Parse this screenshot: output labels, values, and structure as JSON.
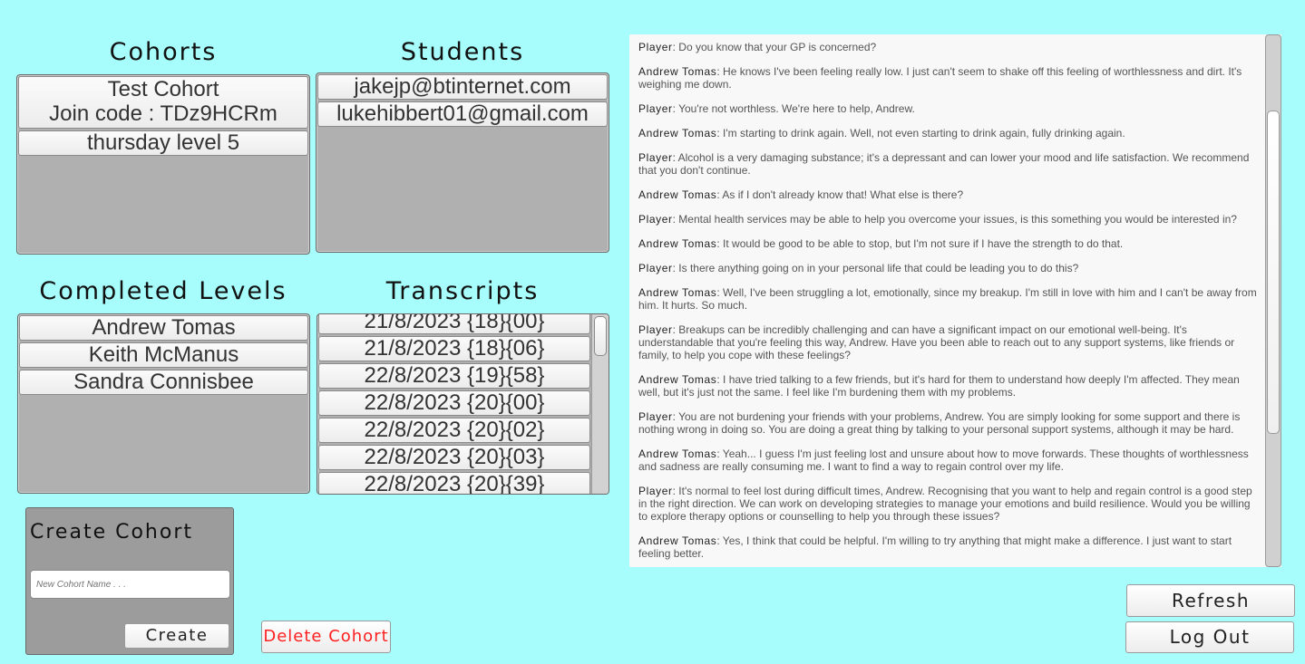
{
  "cohorts": {
    "heading": "Cohorts",
    "items": [
      {
        "line1": "Test Cohort",
        "line2": "Join code : TDz9HCRm"
      },
      {
        "line1": "thursday level 5"
      }
    ]
  },
  "students": {
    "heading": "Students",
    "items": [
      "jakejp@btinternet.com",
      "lukehibbert01@gmail.com"
    ]
  },
  "completed_levels": {
    "heading": "Completed Levels",
    "items": [
      "Andrew Tomas",
      "Keith McManus",
      "Sandra Connisbee"
    ]
  },
  "transcripts": {
    "heading": "Transcripts",
    "items": [
      "21/8/2023 {18}{00}",
      "21/8/2023 {18}{06}",
      "22/8/2023 {19}{58}",
      "22/8/2023 {20}{00}",
      "22/8/2023 {20}{02}",
      "22/8/2023 {20}{03}",
      "22/8/2023 {20}{39}"
    ]
  },
  "create_cohort": {
    "heading": "Create Cohort",
    "placeholder": "New Cohort Name . . .",
    "value": "",
    "create_label": "Create"
  },
  "delete_cohort_label": "Delete Cohort",
  "refresh_label": "Refresh",
  "logout_label": "Log Out",
  "colors": {
    "background": "#a6fdfb",
    "delete_text": "#ff2020"
  },
  "conversation": [
    {
      "speaker": "Player",
      "text": ": Do you know that your GP is concerned?"
    },
    {
      "speaker": "Andrew Tomas",
      "text": ": He knows I've been feeling really low. I just can't seem to shake off this feeling of worthlessness and dirt. It's weighing me down."
    },
    {
      "speaker": "Player",
      "text": ": You're not worthless. We're here to help, Andrew."
    },
    {
      "speaker": "Andrew Tomas",
      "text": ": I'm starting to drink again. Well, not even starting to drink again, fully drinking again."
    },
    {
      "speaker": "Player",
      "text": ": Alcohol is a very damaging substance; it's a depressant and can lower your mood and life satisfaction. We recommend that you don't continue."
    },
    {
      "speaker": "Andrew Tomas",
      "text": ": As if I don't already know that! What else is there?"
    },
    {
      "speaker": "Player",
      "text": ": Mental health services may be able to help you overcome your issues, is this something you would be interested in?"
    },
    {
      "speaker": "Andrew Tomas",
      "text": ": It would be good to be able to stop, but I'm not sure if I have the strength to do that."
    },
    {
      "speaker": "Player",
      "text": ": Is there anything going on in your personal life that could be leading you to do this?"
    },
    {
      "speaker": "Andrew Tomas",
      "text": ": Well, I've been struggling a lot, emotionally, since my breakup. I'm still in love with him and I can't be away from him. It hurts. So much."
    },
    {
      "speaker": "Player",
      "text": ": Breakups can be incredibly challenging and can have a significant impact on our emotional well-being. It's understandable that you're feeling this way, Andrew. Have you been able to reach out to any support systems, like friends or family, to help you cope with these feelings?"
    },
    {
      "speaker": "Andrew Tomas",
      "text": ": I have tried talking to a few friends, but it's hard for them to understand how deeply I'm affected. They mean well, but it's just not the same. I feel like I'm burdening them with my problems."
    },
    {
      "speaker": "Player",
      "text": ": You are not burdening your friends with your problems, Andrew. You are simply looking for some support and there is nothing wrong in doing so. You are doing a great thing by talking to your personal support systems, although it may be hard."
    },
    {
      "speaker": "Andrew Tomas",
      "text": ": Yeah... I guess I'm just feeling lost and unsure about how to move forwards. These thoughts of worthlessness and sadness are really consuming me. I want to find a way to regain control over my life."
    },
    {
      "speaker": "Player",
      "text": ": It's normal to feel lost during difficult times, Andrew. Recognising that you want to help and regain control is a good step in the right direction. We can work on developing strategies to manage your emotions and build resilience. Would you be willing to explore therapy options or counselling to help you through these issues?"
    },
    {
      "speaker": "Andrew Tomas",
      "text": ": Yes, I think that could be helpful. I'm willing to try anything that might make a difference. I just want to start feeling better."
    }
  ]
}
